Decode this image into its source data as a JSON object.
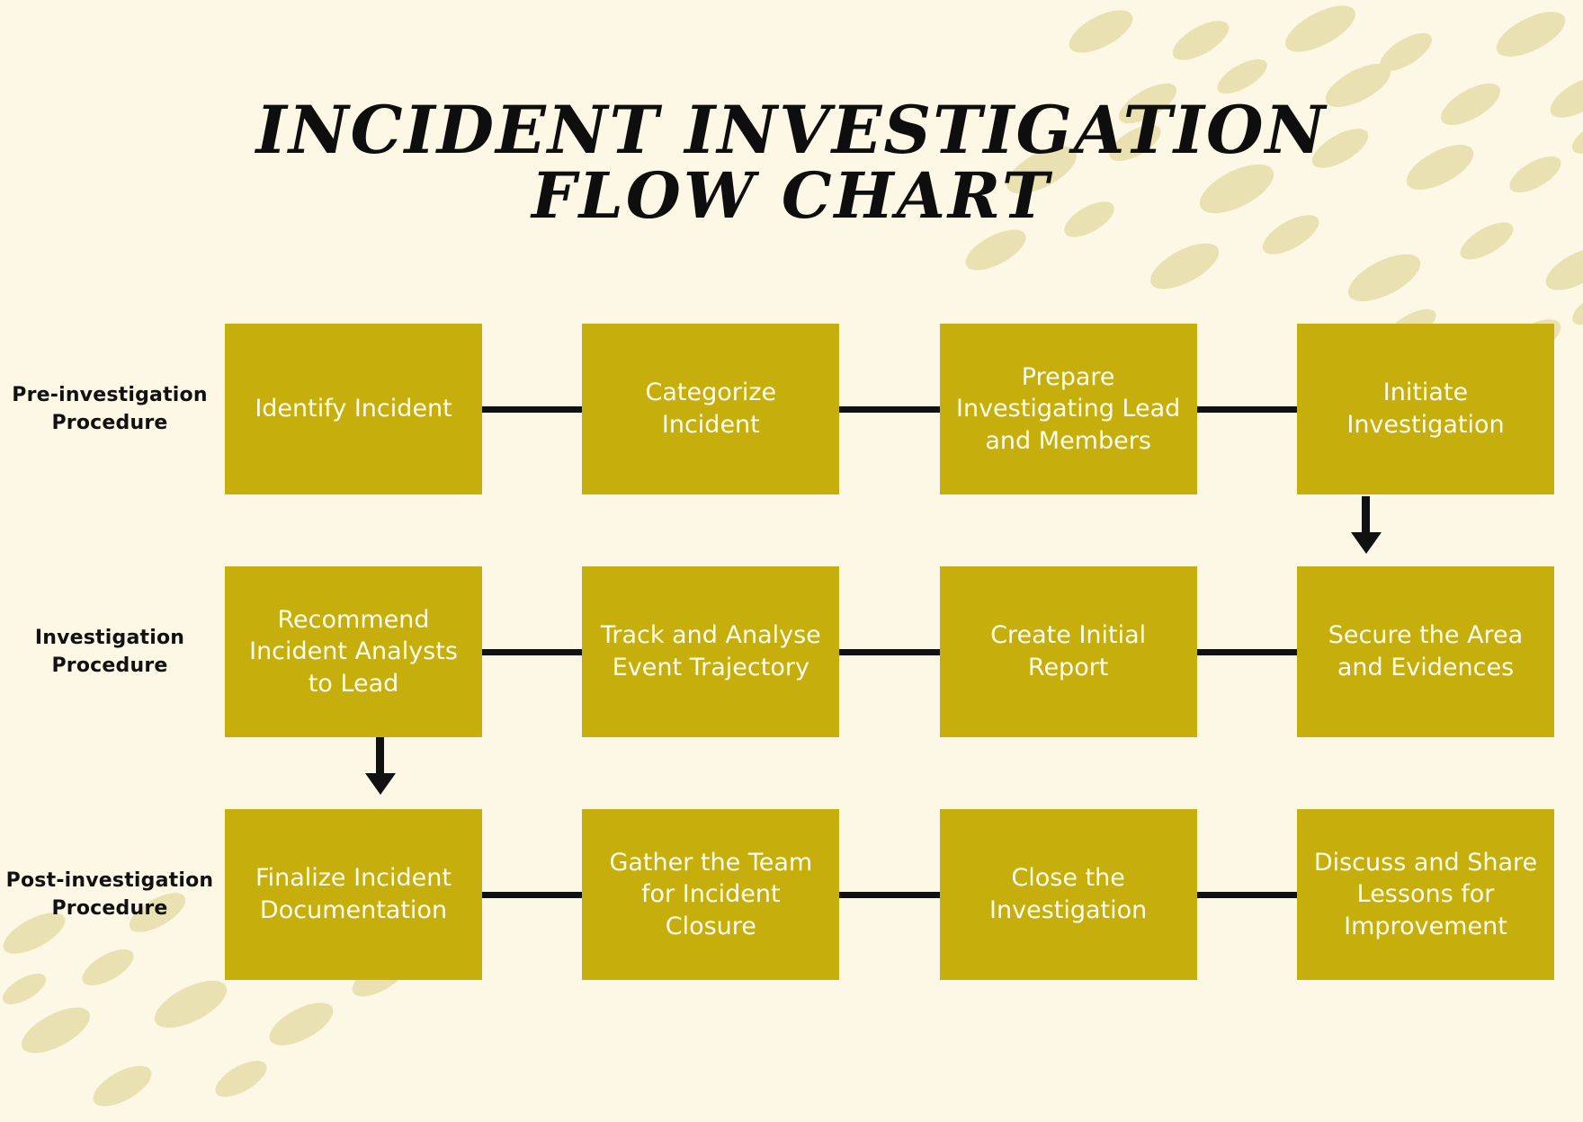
{
  "title": {
    "line1": "INCIDENT INVESTIGATION",
    "line2": "FLOW CHART"
  },
  "colors": {
    "background": "#FDF8E6",
    "node_fill": "#C6AE0C",
    "node_text": "#FFFDF0",
    "connector": "#111111",
    "confetti": "#E9E1B2",
    "heading_text": "#0E0E0E"
  },
  "chart_data": {
    "type": "diagram",
    "title": "INCIDENT INVESTIGATION FLOW CHART",
    "rows": [
      {
        "label": "Pre-investigation Procedure",
        "nodes": [
          "Identify Incident",
          "Categorize Incident",
          "Prepare Investigating Lead and Members",
          "Initiate Investigation"
        ],
        "connectors": [
          "line",
          "line",
          "line"
        ],
        "exit": "down-arrow-from-last-node"
      },
      {
        "label": "Investigation Procedure",
        "nodes": [
          "Recommend Incident Analysts to Lead",
          "Track and Analyse Event Trajectory",
          "Create Initial Report",
          "Secure the Area and Evidences"
        ],
        "connectors": [
          "line",
          "line",
          "line"
        ],
        "exit": "down-arrow-from-first-node"
      },
      {
        "label": "Post-investigation Procedure",
        "nodes": [
          "Finalize Incident Documentation",
          "Gather the Team for Incident Closure",
          "Close the Investigation",
          "Discuss and Share Lessons for Improvement"
        ],
        "connectors": [
          "line",
          "line",
          "line"
        ],
        "exit": "none"
      }
    ]
  },
  "rows": [
    {
      "label": "Pre-investigation Procedure",
      "nodes": [
        {
          "text": "Identify Incident"
        },
        {
          "text": "Categorize Incident"
        },
        {
          "text": "Prepare Investigating Lead and Members"
        },
        {
          "text": "Initiate Investigation"
        }
      ]
    },
    {
      "label": "Investigation Procedure",
      "nodes": [
        {
          "text": "Recommend Incident Analysts to Lead"
        },
        {
          "text": "Track and Analyse Event Trajectory"
        },
        {
          "text": "Create Initial Report"
        },
        {
          "text": "Secure the Area and Evidences"
        }
      ]
    },
    {
      "label": "Post-investigation Procedure",
      "nodes": [
        {
          "text": "Finalize Incident Documentation"
        },
        {
          "text": "Gather the Team for Incident Closure"
        },
        {
          "text": "Close the Investigation"
        },
        {
          "text": "Discuss and Share Lessons for Improvement"
        }
      ]
    }
  ]
}
